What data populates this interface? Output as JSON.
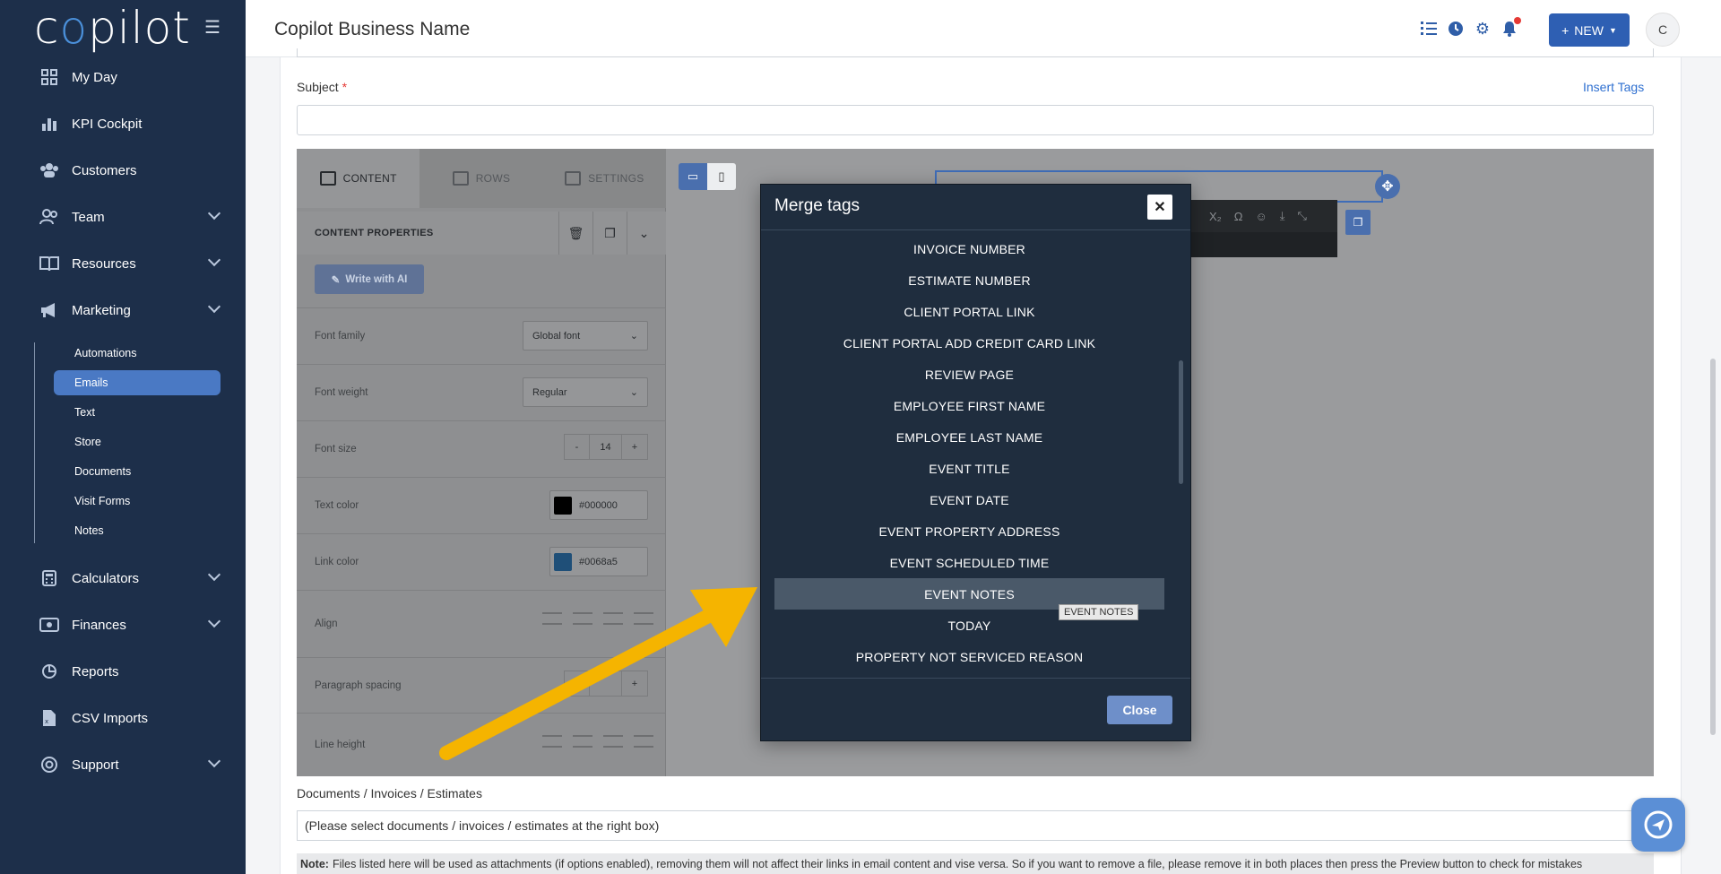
{
  "app": {
    "logo": "copilot",
    "business_name": "Copilot Business Name",
    "new_button": "NEW",
    "avatar_initial": "C"
  },
  "sidebar": {
    "items": [
      {
        "label": "My Day",
        "icon": "grid-icon"
      },
      {
        "label": "KPI Cockpit",
        "icon": "bar-chart-icon"
      },
      {
        "label": "Customers",
        "icon": "users-icon"
      },
      {
        "label": "Team",
        "icon": "user-group-icon",
        "expandable": true
      },
      {
        "label": "Resources",
        "icon": "book-icon",
        "expandable": true
      },
      {
        "label": "Marketing",
        "icon": "megaphone-icon",
        "expandable": true
      },
      {
        "label": "Calculators",
        "icon": "calculator-icon",
        "expandable": true
      },
      {
        "label": "Finances",
        "icon": "money-icon",
        "expandable": true
      },
      {
        "label": "Reports",
        "icon": "pie-chart-icon"
      },
      {
        "label": "CSV Imports",
        "icon": "csv-file-icon"
      },
      {
        "label": "Support",
        "icon": "lifebuoy-icon",
        "expandable": true
      }
    ],
    "marketing_sub": [
      "Automations",
      "Emails",
      "Text",
      "Store",
      "Documents",
      "Visit Forms",
      "Notes"
    ],
    "active_sub": "Emails"
  },
  "form": {
    "subject_label": "Subject",
    "required_mark": "*",
    "insert_tags": "Insert Tags",
    "docs_label": "Documents / Invoices / Estimates",
    "docs_placeholder": "(Please select documents / invoices / estimates at the right box)",
    "note_label": "Note:",
    "note_text": "Files listed here will be used as attachments (if options enabled), removing them will not affect their links in email content and vise versa. So if you want to remove a file, please remove it in both places then press the Preview button to check for mistakes"
  },
  "editor": {
    "tabs": [
      "CONTENT",
      "ROWS",
      "SETTINGS"
    ],
    "content_properties": "CONTENT PROPERTIES",
    "write_ai": "Write with AI",
    "props": {
      "font_family_label": "Font family",
      "font_family_value": "Global font",
      "font_weight_label": "Font weight",
      "font_weight_value": "Regular",
      "font_size_label": "Font size",
      "font_size_value": "14",
      "text_color_label": "Text color",
      "text_color_value": "#000000",
      "link_color_label": "Link color",
      "link_color_value": "#0068a5",
      "align_label": "Align",
      "paragraph_spacing_label": "Paragraph spacing",
      "line_height_label": "Line height"
    }
  },
  "modal": {
    "title": "Merge tags",
    "close_label": "Close",
    "tags": [
      "INVOICE NUMBER",
      "ESTIMATE NUMBER",
      "CLIENT PORTAL LINK",
      "CLIENT PORTAL ADD CREDIT CARD LINK",
      "REVIEW PAGE",
      "EMPLOYEE FIRST NAME",
      "EMPLOYEE LAST NAME",
      "EVENT TITLE",
      "EVENT DATE",
      "EVENT PROPERTY ADDRESS",
      "EVENT SCHEDULED TIME",
      "EVENT NOTES",
      "TODAY",
      "PROPERTY NOT SERVICED REASON"
    ],
    "highlighted": "EVENT NOTES",
    "tooltip": "EVENT NOTES"
  },
  "colors": {
    "sidebar_bg": "#1d2f4a",
    "accent": "#2e5fb3",
    "arrow": "#f5b400"
  }
}
